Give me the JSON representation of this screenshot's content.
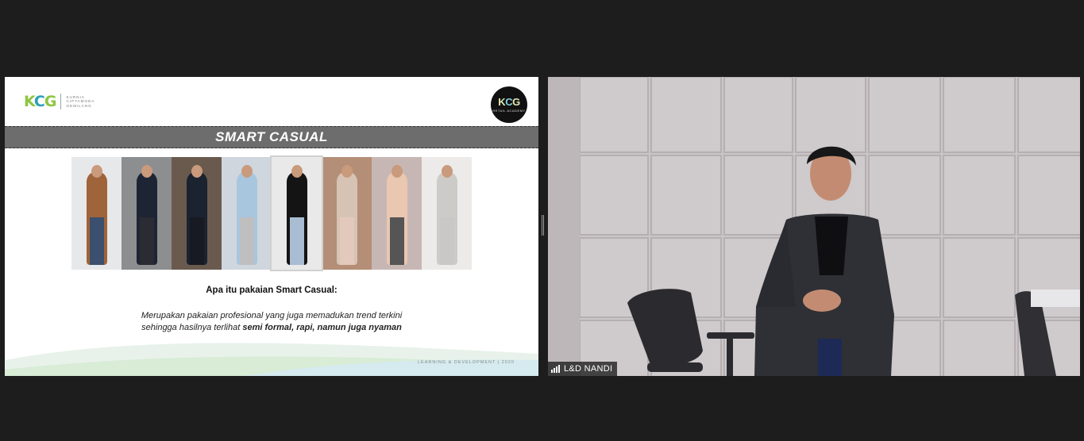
{
  "slide": {
    "logo_mark_k": "K",
    "logo_mark_c": "C",
    "logo_mark_g": "G",
    "logo_sub_lines": [
      "KURNIA",
      "CIPTAMODA",
      "GEMILANG"
    ],
    "badge_mark_k": "K",
    "badge_mark_c": "C",
    "badge_mark_g": "G",
    "badge_sub": "RETAIL ACADEMY",
    "title": "SMART CASUAL",
    "question": "Apa itu pakaian Smart Casual:",
    "desc_line1": "Merupakan pakaian profesional yang juga memadukan trend terkini",
    "desc_line2_prefix": "sehingga hasilnya terlihat ",
    "desc_line2_bold": "semi formal, rapi, namun juga nyaman",
    "footer": "LEARNING & DEVELOPMENT | 2020",
    "photos": [
      {
        "bg": "#e7e8ea",
        "top": "#a0643a",
        "bottom": "#3b4f6e"
      },
      {
        "bg": "#8d8e90",
        "top": "#1d2433",
        "bottom": "#2b2c33"
      },
      {
        "bg": "#6a5a4e",
        "top": "#1b2230",
        "bottom": "#171a22"
      },
      {
        "bg": "#cfd6de",
        "top": "#a9c6df",
        "bottom": "#bfbfbf"
      },
      {
        "bg": "#e9e9ea",
        "top": "#141414",
        "bottom": "#a8bcd2"
      },
      {
        "bg": "#b48e76",
        "top": "#d6c3b4",
        "bottom": "#e3c9bc"
      },
      {
        "bg": "#c7b7b4",
        "top": "#e9c7b1",
        "bottom": "#555555"
      },
      {
        "bg": "#ecebe9",
        "top": "#cdcbc8",
        "bottom": "#c9c8c6"
      }
    ]
  },
  "video": {
    "participant_name": "L&D NANDI",
    "bg": "#c9c5c6"
  }
}
